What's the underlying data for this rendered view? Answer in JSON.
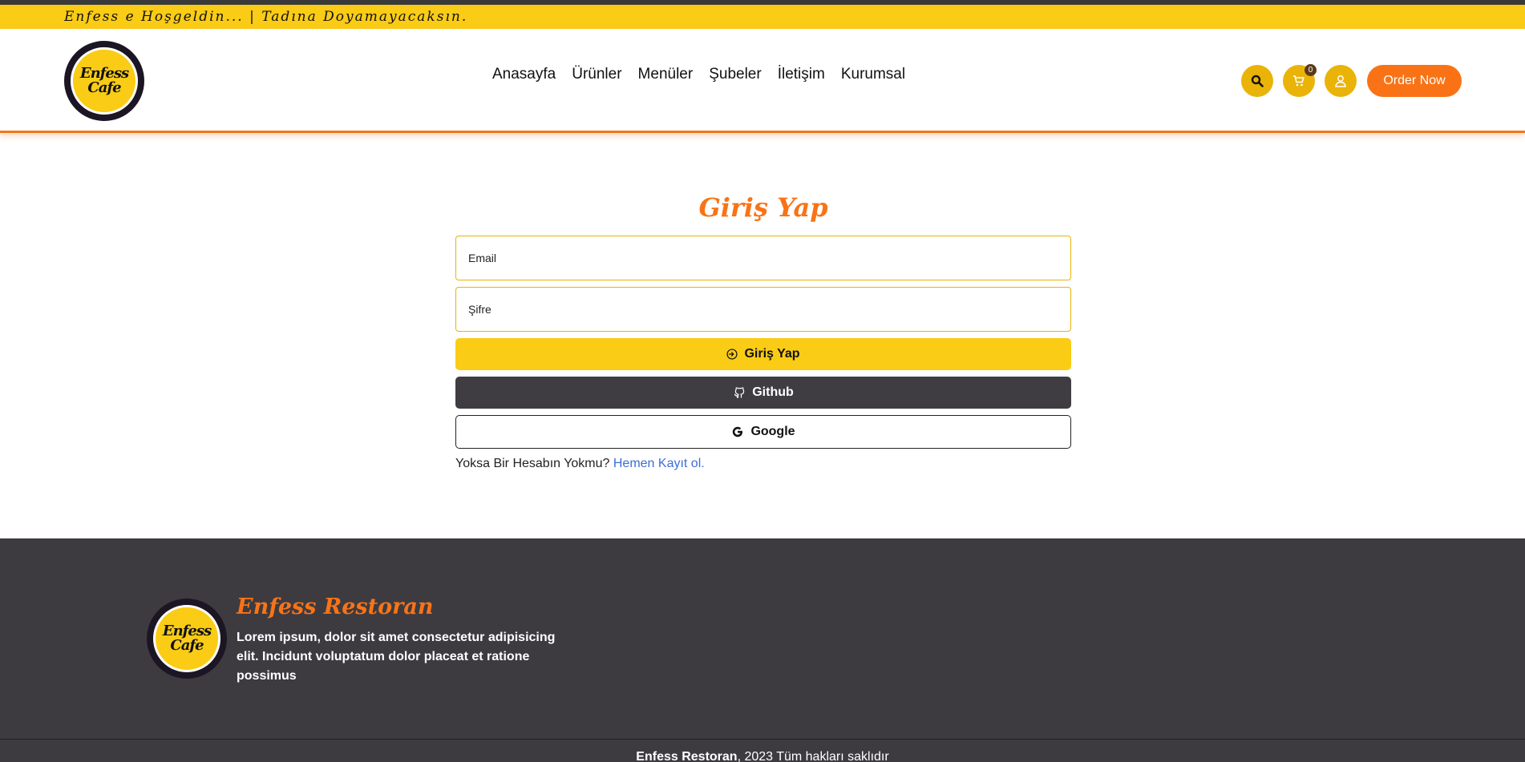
{
  "topbar": {
    "welcome": "Enfess e Hoşgeldin... | Tadına Doyamayacaksın."
  },
  "brand": {
    "logo_line1": "Enfess",
    "logo_line2": "Cafe"
  },
  "nav": {
    "items": [
      {
        "label": "Anasayfa"
      },
      {
        "label": "Ürünler"
      },
      {
        "label": "Menüler"
      },
      {
        "label": "Şubeler"
      },
      {
        "label": "İletişim"
      },
      {
        "label": "Kurumsal"
      }
    ]
  },
  "header_actions": {
    "search_icon": "search-icon",
    "cart_icon": "cart-icon",
    "cart_count": "0",
    "user_icon": "user-icon",
    "order_label": "Order Now"
  },
  "login": {
    "title": "Giriş Yap",
    "email_placeholder": "Email",
    "password_placeholder": "Şifre",
    "submit_label": "Giriş Yap",
    "github_label": "Github",
    "google_label": "Google",
    "register_prompt": "Yoksa Bir Hesabın Yokmu?",
    "register_link": "Hemen Kayıt ol."
  },
  "footer": {
    "title": "Enfess Restoran",
    "description": "Lorem ipsum, dolor sit amet consectetur adipisicing elit. Incidunt voluptatum dolor placeat et ratione possimus",
    "copyright_brand": "Enfess Restoran",
    "copyright_text": "2023 Tüm hakları saklıdır"
  },
  "colors": {
    "accent_yellow": "#facc15",
    "accent_orange": "#f97316",
    "footer_bg": "#3d3b40",
    "link_blue": "#3b6fd6"
  }
}
